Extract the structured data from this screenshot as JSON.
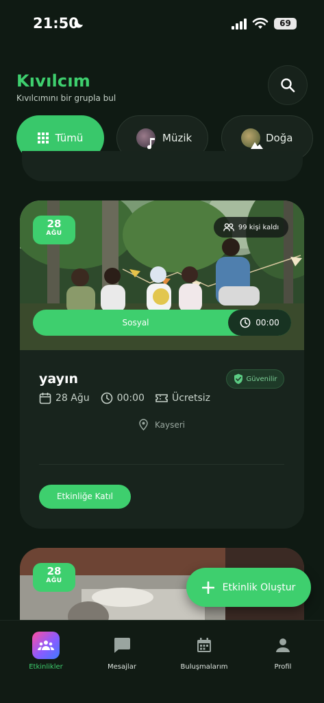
{
  "status": {
    "time": "21:50",
    "battery": "69"
  },
  "header": {
    "title": "Kıvılcım",
    "subtitle": "Kıvılcımını bir grupla bul"
  },
  "chips": [
    {
      "label": "Tümü",
      "icon": "grid-icon",
      "active": true
    },
    {
      "label": "Müzik",
      "icon": "music-note-icon",
      "active": false
    },
    {
      "label": "Doğa",
      "icon": "mountain-icon",
      "active": false
    }
  ],
  "event_card": {
    "date_day": "28",
    "date_month": "AĞU",
    "spots_left": "99 kişi kaldı",
    "category": "Sosyal",
    "time": "00:00",
    "title": "yayın",
    "trusted": "Güvenilir",
    "meta_date": "28 Ağu",
    "meta_time": "00:00",
    "price": "Ücretsiz",
    "location": "Kayseri",
    "join_label": "Etkinliğe Katıl"
  },
  "next_card": {
    "date_day": "28",
    "date_month": "AĞU"
  },
  "fab": {
    "label": "Etkinlik Oluştur"
  },
  "nav": [
    {
      "label": "Etkinlikler",
      "icon": "group-icon",
      "active": true
    },
    {
      "label": "Mesajlar",
      "icon": "chat-icon",
      "active": false
    },
    {
      "label": "Buluşmalarım",
      "icon": "calendar-icon",
      "active": false
    },
    {
      "label": "Profil",
      "icon": "person-icon",
      "active": false
    }
  ],
  "colors": {
    "accent": "#3ecf6e",
    "background": "#0f1a13",
    "card": "#18241d"
  }
}
